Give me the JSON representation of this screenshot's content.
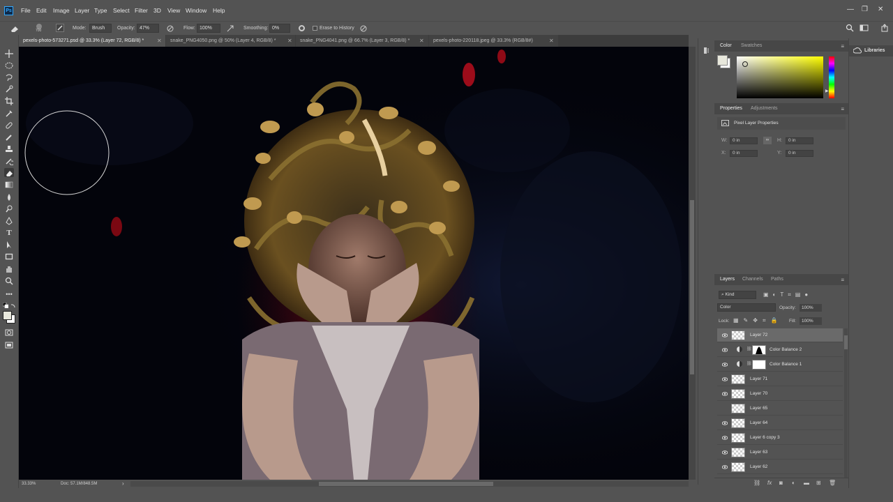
{
  "app": {
    "logo": "Ps"
  },
  "menu": [
    "File",
    "Edit",
    "Image",
    "Layer",
    "Type",
    "Select",
    "Filter",
    "3D",
    "View",
    "Window",
    "Help"
  ],
  "window_controls": [
    "—",
    "❐",
    "✕"
  ],
  "options": {
    "brush_size": "700",
    "mode_label": "Mode:",
    "mode_value": "Brush",
    "opacity_label": "Opacity:",
    "opacity_value": "47%",
    "flow_label": "Flow:",
    "flow_value": "100%",
    "smoothing_label": "Smoothing:",
    "smoothing_value": "0%",
    "erase_history": "Erase to History"
  },
  "tabs": [
    {
      "label": "pexels-photo-573271.psd @ 33.3% (Layer 72, RGB/8) *",
      "active": true
    },
    {
      "label": "snake_PNG4050.png @ 50% (Layer 4, RGB/8) *",
      "active": false
    },
    {
      "label": "snake_PNG4041.png @ 66.7% (Layer 3, RGB/8) *",
      "active": false
    },
    {
      "label": "pexels-photo-220118.jpeg @ 33.3% (RGB/8#)",
      "active": false
    }
  ],
  "status": {
    "zoom": "33.33%",
    "doc": "Doc: 57.1M/848.5M"
  },
  "color_panel": {
    "tabs": [
      "Color",
      "Swatches"
    ],
    "hue": "#ffff00"
  },
  "properties_panel": {
    "tabs": [
      "Properties",
      "Adjustments"
    ],
    "heading": "Pixel Layer Properties",
    "w_label": "W:",
    "w_value": "0 in",
    "h_label": "H:",
    "h_value": "0 in",
    "x_label": "X:",
    "x_value": "0 in",
    "y_label": "Y:",
    "y_value": "0 in"
  },
  "layers_panel": {
    "tabs": [
      "Layers",
      "Channels",
      "Paths"
    ],
    "filter_kind": "Kind",
    "blend_mode": "Color",
    "opacity_label": "Opacity:",
    "opacity_value": "100%",
    "lock_label": "Lock:",
    "fill_label": "Fill:",
    "fill_value": "100%",
    "layers": [
      {
        "name": "Layer 72",
        "type": "pixel",
        "visible": true,
        "selected": true
      },
      {
        "name": "Color Balance 2",
        "type": "adjustment",
        "visible": true,
        "selected": false
      },
      {
        "name": "Color Balance 1",
        "type": "adjustment",
        "visible": true,
        "selected": false
      },
      {
        "name": "Layer 71",
        "type": "pixel",
        "visible": true,
        "selected": false
      },
      {
        "name": "Layer 70",
        "type": "pixel",
        "visible": true,
        "selected": false
      },
      {
        "name": "Layer 65",
        "type": "pixel",
        "visible": false,
        "selected": false
      },
      {
        "name": "Layer 64",
        "type": "pixel",
        "visible": true,
        "selected": false
      },
      {
        "name": "Layer 6 copy 3",
        "type": "pixel",
        "visible": true,
        "selected": false
      },
      {
        "name": "Layer 63",
        "type": "pixel",
        "visible": true,
        "selected": false
      },
      {
        "name": "Layer 62",
        "type": "pixel",
        "visible": true,
        "selected": false
      }
    ]
  },
  "libraries": {
    "label": "Libraries"
  }
}
